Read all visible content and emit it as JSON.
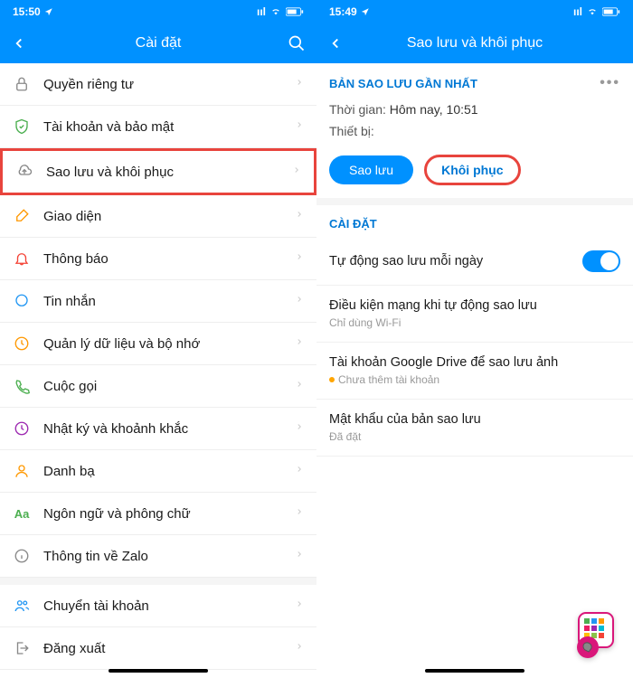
{
  "left": {
    "status": {
      "time": "15:50",
      "signal": "ıl",
      "wifi": "📶",
      "battery": "■"
    },
    "nav": {
      "title": "Cài đặt"
    },
    "items": [
      {
        "icon": "lock",
        "label": "Quyền riêng tư",
        "highlight": false
      },
      {
        "icon": "shield",
        "label": "Tài khoản và bảo mật",
        "highlight": false
      },
      {
        "icon": "cloud",
        "label": "Sao lưu và khôi phục",
        "highlight": true
      },
      {
        "icon": "brush",
        "label": "Giao diện",
        "highlight": false
      },
      {
        "icon": "bell",
        "label": "Thông báo",
        "highlight": false
      },
      {
        "icon": "message",
        "label": "Tin nhắn",
        "highlight": false
      },
      {
        "icon": "clock",
        "label": "Quản lý dữ liệu và bộ nhớ",
        "highlight": false
      },
      {
        "icon": "phone",
        "label": "Cuộc gọi",
        "highlight": false
      },
      {
        "icon": "clock2",
        "label": "Nhật ký và khoảnh khắc",
        "highlight": false
      },
      {
        "icon": "contacts",
        "label": "Danh bạ",
        "highlight": false
      },
      {
        "icon": "aa",
        "label": "Ngôn ngữ và phông chữ",
        "highlight": false
      },
      {
        "icon": "info",
        "label": "Thông tin về Zalo",
        "highlight": false
      },
      {
        "icon": "switch",
        "label": "Chuyển tài khoản",
        "highlight": false,
        "gap": true
      },
      {
        "icon": "logout",
        "label": "Đăng xuất",
        "highlight": false
      }
    ]
  },
  "right": {
    "status": {
      "time": "15:49"
    },
    "nav": {
      "title": "Sao lưu và khôi phục"
    },
    "section1_title": "BẢN SAO LƯU GẦN NHẤT",
    "time_label": "Thời gian:",
    "time_value": "Hôm nay, 10:51",
    "device_label": "Thiết bị:",
    "btn_backup": "Sao lưu",
    "btn_restore": "Khôi phục",
    "section2_title": "CÀI ĐẶT",
    "settings": [
      {
        "label": "Tự động sao lưu mỗi ngày",
        "toggle": true
      },
      {
        "label": "Điều kiện mạng khi tự động sao lưu",
        "sub": "Chỉ dùng Wi-Fi"
      },
      {
        "label": "Tài khoản Google Drive để sao lưu ảnh",
        "sub": "Chưa thêm tài khoản",
        "warn": true
      },
      {
        "label": "Mật khẩu của bản sao lưu",
        "sub": "Đã đặt"
      }
    ]
  }
}
